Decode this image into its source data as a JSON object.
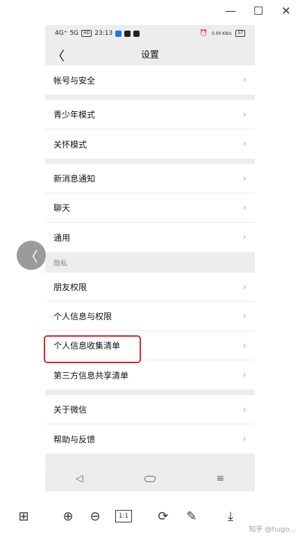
{
  "window": {
    "minimize_icon": "minimize-icon",
    "maximize_icon": "maximize-icon",
    "close_icon": "close-icon",
    "min_glyph": "—",
    "max_glyph": "☐",
    "close_glyph": "✕"
  },
  "statusbar": {
    "signal_4g": "4G⁺",
    "signal_5g": "5G",
    "hd": "HD",
    "time": "23:13",
    "speed": "0.00 KB/s",
    "battery": "57"
  },
  "navbar": {
    "back_glyph": "〈",
    "title": "设置"
  },
  "groups": [
    {
      "rows": [
        "帐号与安全"
      ]
    },
    {
      "rows": [
        "青少年模式",
        "关怀模式"
      ]
    },
    {
      "rows": [
        "新消息通知",
        "聊天",
        "通用"
      ]
    }
  ],
  "privacy": {
    "label": "隐私",
    "rows": [
      "朋友权限",
      "个人信息与权限",
      "个人信息收集清单",
      "第三方信息共享清单"
    ]
  },
  "about_group": {
    "rows": [
      "关于微信",
      "帮助与反馈"
    ]
  },
  "chevron": "›",
  "phone_nav": {
    "back": "◁",
    "menu": "≡"
  },
  "float_back_glyph": "〈",
  "toolbar": {
    "grid": "⊞",
    "zoom_in": "⊕",
    "zoom_out": "⊖",
    "zoom_11": "1:1",
    "rotate": "⟳",
    "edit": "✎",
    "download": "⤓"
  },
  "watermark": "知乎 @hugo..."
}
